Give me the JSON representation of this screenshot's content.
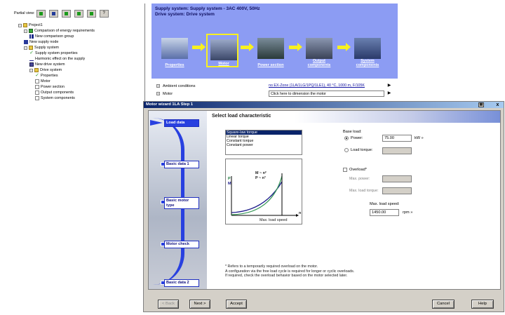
{
  "partial_view": {
    "label": "Partial view:",
    "help_glyph": "?"
  },
  "tree": [
    {
      "label": "Project1",
      "icon": "folder-icon",
      "indent": 0
    },
    {
      "label": "Comparison of energy requirements",
      "icon": "green-folder-icon",
      "indent": 1
    },
    {
      "label": "New comparison group",
      "icon": "bars-icon",
      "indent": 2
    },
    {
      "label": "New supply node",
      "icon": "node-icon",
      "indent": 1
    },
    {
      "label": "Supply system",
      "icon": "folder-icon",
      "indent": 1
    },
    {
      "label": "Supply system properties",
      "icon": "check-icon",
      "indent": 2
    },
    {
      "label": "Harmonic effect on the supply",
      "icon": "wave-icon",
      "indent": 2
    },
    {
      "label": "New drive system",
      "icon": "drive-icon",
      "indent": 2
    },
    {
      "label": "Drive system",
      "icon": "folder-icon",
      "indent": 2
    },
    {
      "label": "Properties",
      "icon": "check-icon",
      "indent": 3
    },
    {
      "label": "Motor",
      "icon": "doc-icon",
      "indent": 3
    },
    {
      "label": "Power section",
      "icon": "doc-icon",
      "indent": 3
    },
    {
      "label": "Output components",
      "icon": "doc-icon",
      "indent": 3
    },
    {
      "label": "System components",
      "icon": "doc-icon",
      "indent": 3
    }
  ],
  "top": {
    "supply_line": "Supply system: Supply system - 3AC 400V, 50Hz",
    "drive_line": "Drive system: Drive system",
    "steps": [
      "Properties",
      "Motor",
      "Power section",
      "Output components",
      "System components"
    ],
    "active_step": "Motor",
    "props": [
      {
        "label": "Ambient conditions",
        "value": "no EX-Zone (1LA/1LG/1PQ/1LE1), 40 °C, 1000 m, F/105K"
      },
      {
        "label": "Motor",
        "value": "Click here to dimension the motor"
      }
    ],
    "expand_glyph": "▶"
  },
  "wizard": {
    "title": "Motor wizard 1LA  Step 1",
    "close_glyph": "x",
    "steps": [
      "Load data",
      "Basic data 1",
      "Basic motor type",
      "Motor check",
      "Basic data 2"
    ],
    "current_step": "Load data",
    "heading": "Select load characteristic",
    "load_types": [
      "Square-law torque",
      "Linear torque",
      "Constant torque",
      "Constant power"
    ],
    "selected_load": "Square-law torque",
    "graph": {
      "label_m": "M ~ n²",
      "label_p": "P ~ n³",
      "axis_p": "P",
      "axis_m": "M",
      "axis_n": "n",
      "caption": "Max. load speed"
    },
    "base_load": {
      "label": "Base load:",
      "power_label": "Power:",
      "power_value": "75.00",
      "power_unit": "kW",
      "torque_label": "Load torque:",
      "torque_value": "",
      "power_selected": true
    },
    "overload": {
      "label": "Overload*",
      "max_power_label": "Max. power:",
      "max_torque_label": "Max. load torque:"
    },
    "max_speed": {
      "label": "Max. load speed:",
      "value": "1450.00",
      "unit": "rpm"
    },
    "info_glyph": "»",
    "footnote": [
      "* Refers to a temporarily required overload on the motor.",
      "A configuration via the free load cycle is required for longer or cyclic overloads.",
      "If required, check the overload behavior based on the motor selected later."
    ],
    "buttons": {
      "back": "< Back",
      "next": "Next >",
      "accept": "Accept",
      "cancel": "Cancel",
      "help": "Help"
    }
  }
}
